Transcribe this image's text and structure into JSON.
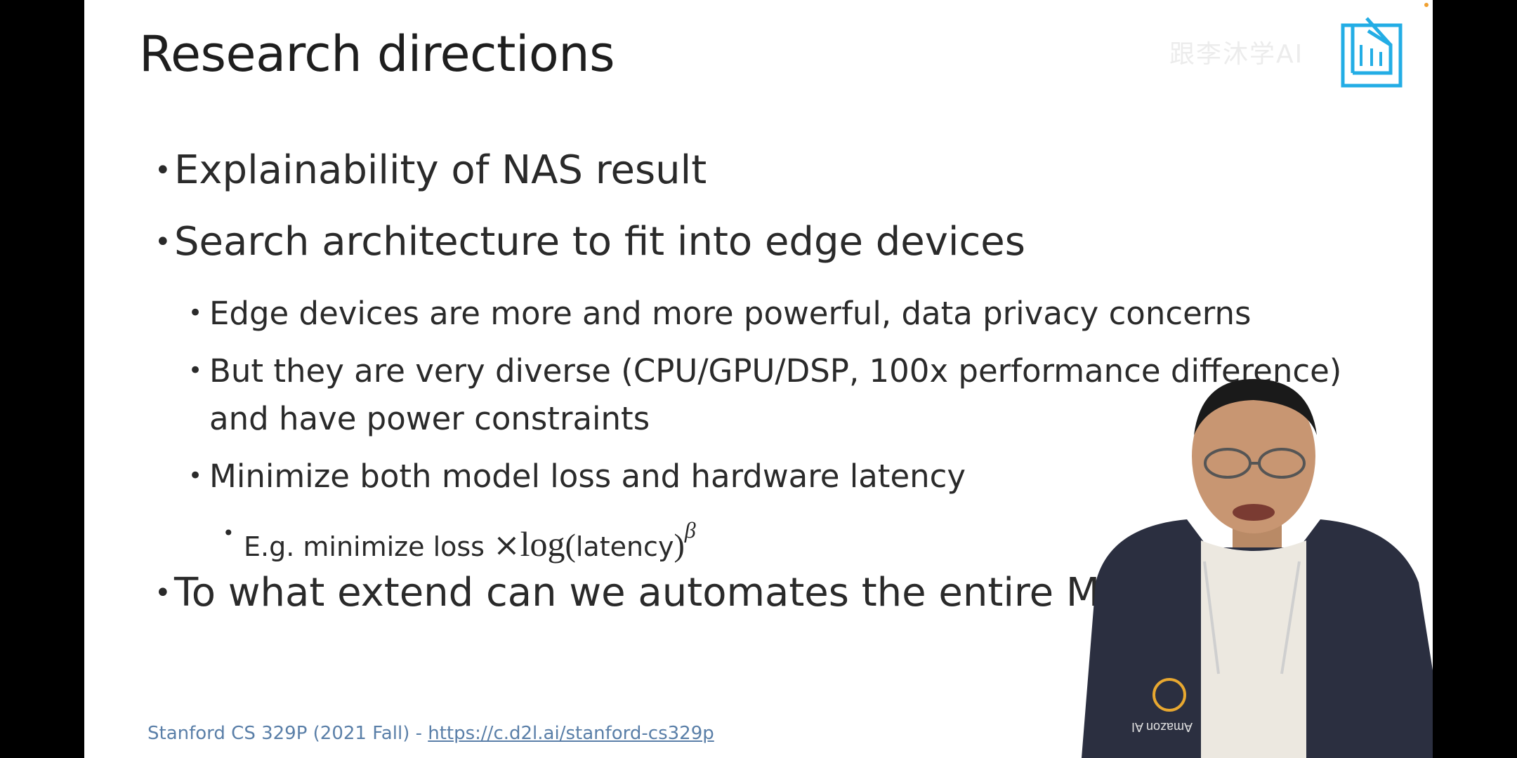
{
  "slide": {
    "title": "Research directions",
    "watermark": "跟李沐学AI",
    "bullets": [
      {
        "level": 1,
        "text": "Explainability of NAS result"
      },
      {
        "level": 1,
        "text": "Search architecture to fit into edge devices"
      },
      {
        "level": 2,
        "text": "Edge devices are more and more powerful, data privacy concerns"
      },
      {
        "level": 2,
        "text": "But they are very diverse (CPU/GPU/DSP, 100x performance difference)",
        "continuation": "and have power constraints"
      },
      {
        "level": 2,
        "text": "Minimize both model loss and hardware latency"
      },
      {
        "level": 3,
        "text_prefix": "E.g. minimize loss",
        "math_times": "×",
        "math_log": "log",
        "math_paren_open": "(",
        "math_arg": "latency",
        "math_paren_close": ")",
        "math_exp": "β"
      },
      {
        "level": 1,
        "text": "To what extend can we automates the entire ML w"
      }
    ],
    "footer_text": "Stanford CS 329P (2021 Fall) - ",
    "footer_link": "https://c.d2l.ai/stanford-cs329p"
  },
  "overlay": {
    "speaker_logo_text": "Amazon AI",
    "accent_colors": {
      "bili_blue": "#23ade5",
      "footer_blue": "#5a7fa8",
      "hoodie": "#2b2f40"
    }
  }
}
